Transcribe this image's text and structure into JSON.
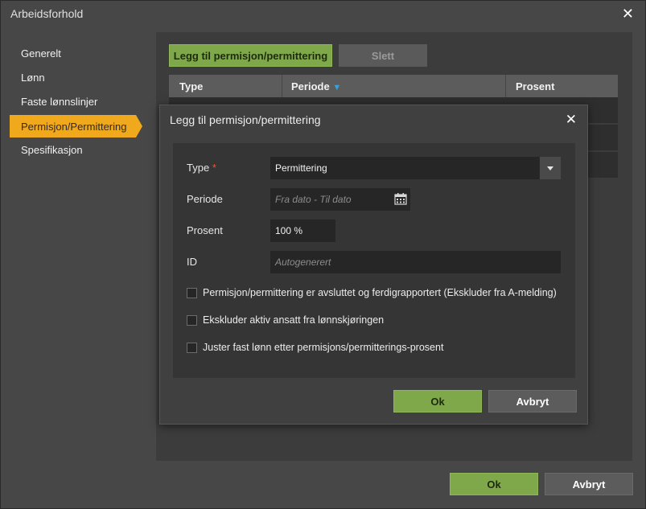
{
  "window": {
    "title": "Arbeidsforhold"
  },
  "sidebar": {
    "items": [
      {
        "label": "Generelt"
      },
      {
        "label": "Lønn"
      },
      {
        "label": "Faste lønnslinjer"
      },
      {
        "label": "Permisjon/Permittering",
        "active": true
      },
      {
        "label": "Spesifikasjon"
      }
    ]
  },
  "toolbar": {
    "add_label": "Legg til permisjon/permittering",
    "delete_label": "Slett"
  },
  "table": {
    "columns": [
      "Type",
      "Periode",
      "Prosent"
    ],
    "sort_indicator": "▼"
  },
  "modal": {
    "title": "Legg til permisjon/permittering",
    "fields": {
      "type": {
        "label": "Type",
        "required_mark": "*",
        "value": "Permittering"
      },
      "periode": {
        "label": "Periode",
        "placeholder": "Fra dato - Til dato"
      },
      "prosent": {
        "label": "Prosent",
        "value": "100 %"
      },
      "id": {
        "label": "ID",
        "placeholder": "Autogenerert"
      }
    },
    "checkboxes": [
      {
        "label": "Permisjon/permittering er avsluttet og ferdigrapportert (Ekskluder fra A-melding)",
        "checked": false
      },
      {
        "label": "Ekskluder aktiv ansatt fra lønnskjøringen",
        "checked": false
      },
      {
        "label": "Juster fast lønn etter permisjons/permitterings-prosent",
        "checked": false
      }
    ],
    "ok_label": "Ok",
    "cancel_label": "Avbryt"
  },
  "footer": {
    "ok_label": "Ok",
    "cancel_label": "Avbryt"
  },
  "colors": {
    "accent": "#f0a81c",
    "primary_button": "#7fa84a",
    "sort_arrow": "#3aa0d8",
    "required": "#e05a3a"
  }
}
